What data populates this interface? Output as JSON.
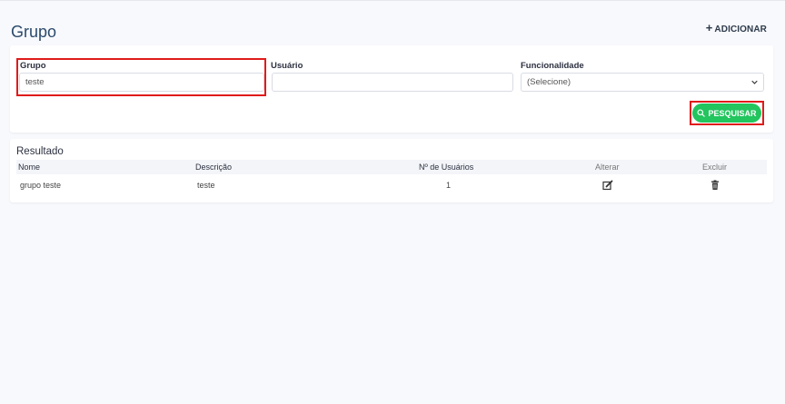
{
  "header": {
    "title": "Grupo",
    "add_label": "ADICIONAR",
    "add_icon": "plus-icon"
  },
  "filters": {
    "grupo": {
      "label": "Grupo",
      "value": "teste"
    },
    "usuario": {
      "label": "Usuário",
      "value": ""
    },
    "funcionalidade": {
      "label": "Funcionalidade",
      "selected": "(Selecione)"
    },
    "search_label": "PESQUISAR",
    "search_icon": "search-icon"
  },
  "results": {
    "title": "Resultado",
    "columns": [
      "Nome",
      "Descrição",
      "Nº de Usuários",
      "Alterar",
      "Excluir"
    ],
    "rows": [
      {
        "nome": "grupo teste",
        "descricao": "teste",
        "usuarios": "1",
        "edit_icon": "edit-icon",
        "delete_icon": "trash-icon"
      }
    ]
  },
  "colors": {
    "accent_green": "#22c55e",
    "title_blue": "#2b4a6b",
    "highlight_red": "#e01b1b"
  }
}
